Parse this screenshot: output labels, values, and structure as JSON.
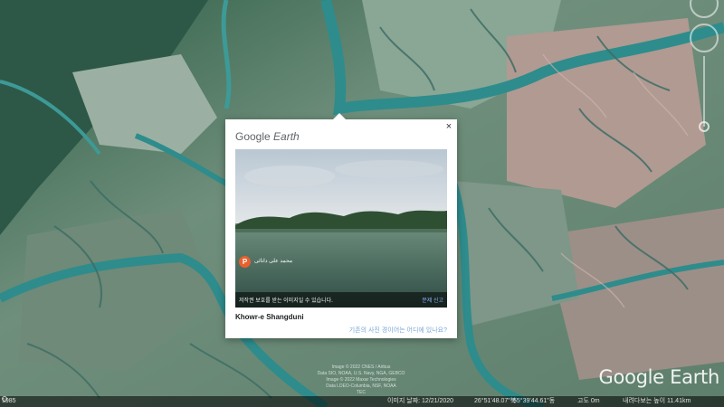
{
  "popup": {
    "logo_google": "Google",
    "logo_earth": "Earth",
    "close_glyph": "×",
    "photo": {
      "author_initial": "P",
      "author_name": "محمد علی دانائی",
      "copyright_notice": "저작권 보호를 받는 이미지일 수 있습니다.",
      "report_label": "문제 신고"
    },
    "place_title": "Khowr-e Shangduni",
    "where_link": "기존의 사진 경이어는 어디에 있나요?"
  },
  "map": {
    "attribution_lines": [
      "Image © 2022 CNES / Airbus",
      "Data SIO, NOAA, U.S. Navy, NGA, GEBCO",
      "Image © 2022 Maxar Technologies",
      "Data LDEO-Columbia, NSF, NOAA",
      "TEC"
    ],
    "logo": "Google Earth"
  },
  "status_bar": {
    "year": "1985",
    "imagery_date": "이미지 날짜: 12/21/2020",
    "latitude": "26°51'48.07\"북",
    "longitude": "55°39'44.61\"동",
    "elevation": "고도   0m",
    "eye_alt": "내려다보는 높이  11.41km"
  },
  "colors": {
    "water": "#2e8c8c",
    "land": "#7a9a86",
    "popup_bg": "#ffffff",
    "link": "#7aa7d8",
    "avatar": "#e8602c"
  }
}
